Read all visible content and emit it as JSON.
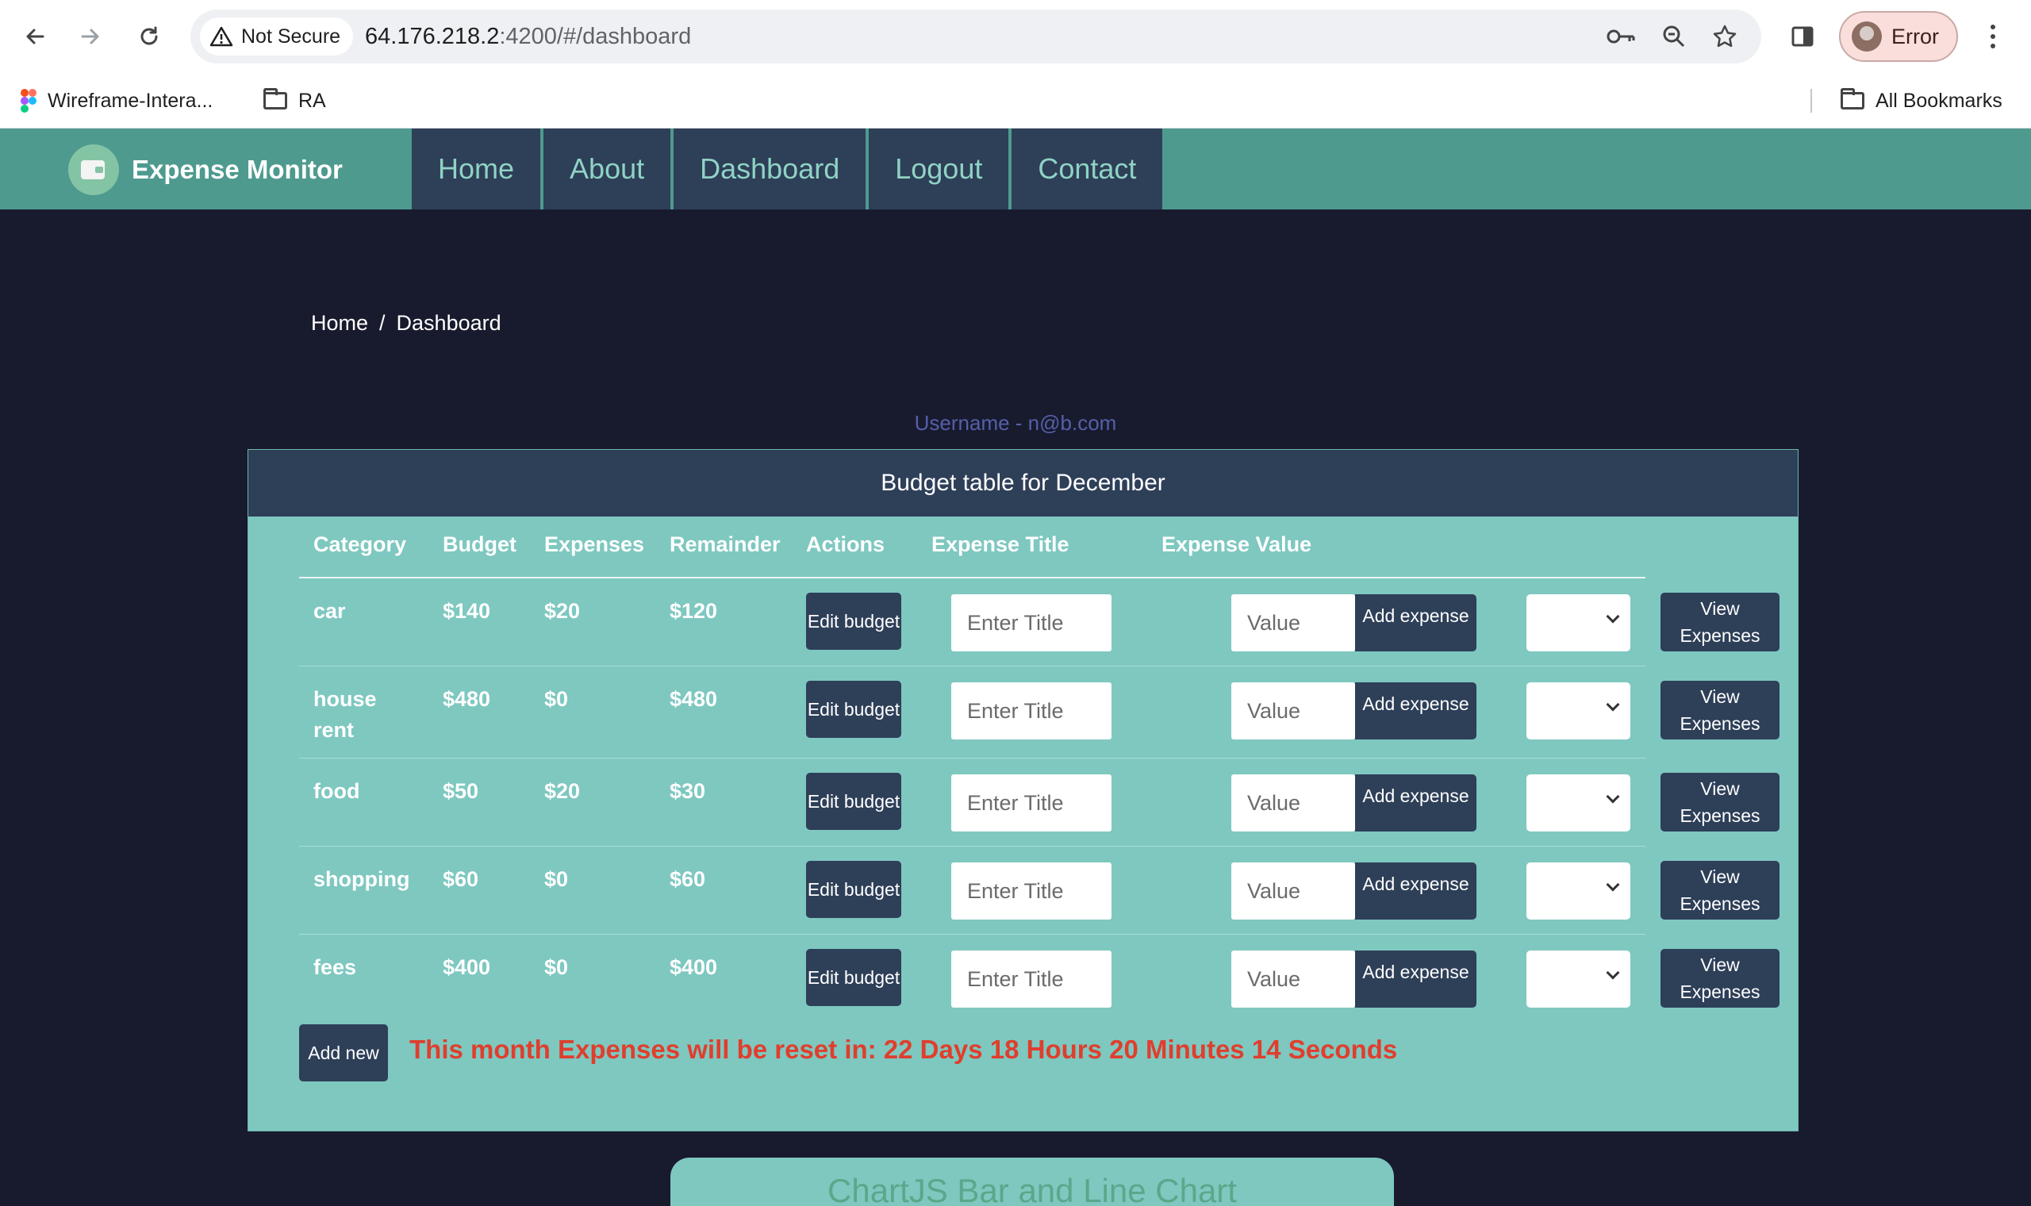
{
  "browser": {
    "security_label": "Not Secure",
    "url_host": "64.176.218.2",
    "url_rest": ":4200/#/dashboard",
    "profile_label": "Error",
    "bookmarks": [
      "Wireframe-Intera...",
      "RA"
    ],
    "all_bookmarks": "All Bookmarks"
  },
  "app": {
    "brand": "Expense Monitor",
    "nav": [
      "Home",
      "About",
      "Dashboard",
      "Logout",
      "Contact"
    ]
  },
  "breadcrumb": {
    "home": "Home",
    "separator": "/",
    "current": "Dashboard"
  },
  "username": "Username - n@b.com",
  "table": {
    "title": "Budget table for December",
    "headers": [
      "Category",
      "Budget",
      "Expenses",
      "Remainder",
      "Actions",
      "Expense Title",
      "Expense Value"
    ],
    "rows": [
      {
        "category": "car",
        "budget": "$140",
        "expenses": "$20",
        "remainder": "$120"
      },
      {
        "category": "house rent",
        "budget": "$480",
        "expenses": "$0",
        "remainder": "$480"
      },
      {
        "category": "food",
        "budget": "$50",
        "expenses": "$20",
        "remainder": "$30"
      },
      {
        "category": "shopping",
        "budget": "$60",
        "expenses": "$0",
        "remainder": "$60"
      },
      {
        "category": "fees",
        "budget": "$400",
        "expenses": "$0",
        "remainder": "$400"
      }
    ],
    "edit_budget_label": "Edit budget",
    "title_placeholder": "Enter Title",
    "value_placeholder": "Value",
    "add_expense_label": "Add expense",
    "view_expenses_label": "View Expenses",
    "add_new_label": "Add new",
    "reset_message": "This month Expenses will be reset in: 22 Days 18 Hours 20 Minutes 14 Seconds"
  },
  "chart_section": {
    "title": "ChartJS Bar and Line Chart"
  }
}
